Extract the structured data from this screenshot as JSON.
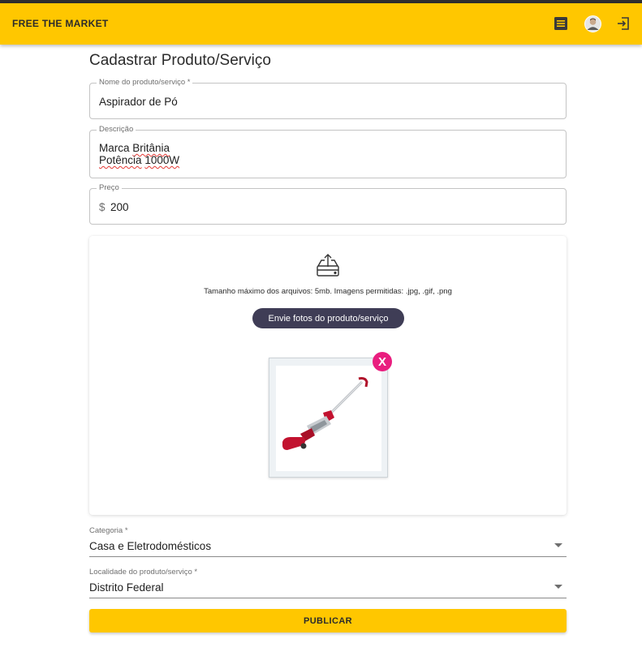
{
  "appbar": {
    "brand": "FREE THE MARKET",
    "icons": [
      "list-icon",
      "avatar",
      "logout-icon"
    ],
    "color": "#ffc700"
  },
  "page": {
    "title": "Cadastrar Produto/Serviço"
  },
  "form": {
    "name": {
      "label": "Nome do produto/serviço *",
      "value": "Aspirador de Pó"
    },
    "description": {
      "label": "Descrição",
      "line1_a": "Marca",
      "line1_b": "Britânia",
      "line2_a": "Potência",
      "line2_b": "1000W"
    },
    "price": {
      "label": "Preço",
      "prefix": "$",
      "value": "200"
    },
    "upload": {
      "hint": "Tamanho máximo dos arquivos: 5mb. Imagens permitidas: .jpg, .gif, .png",
      "button_label": "Envie fotos do produto/serviço",
      "remove_label": "X"
    },
    "category": {
      "label": "Categoria *",
      "value": "Casa e Eletrodomésticos"
    },
    "location": {
      "label": "Localidade do produto/serviço *",
      "value": "Distrito Federal"
    },
    "submit_label": "PUBLICAR"
  },
  "colors": {
    "accent": "#ffc700",
    "button_dark": "#3f3d56",
    "remove": "#e91e7f"
  }
}
